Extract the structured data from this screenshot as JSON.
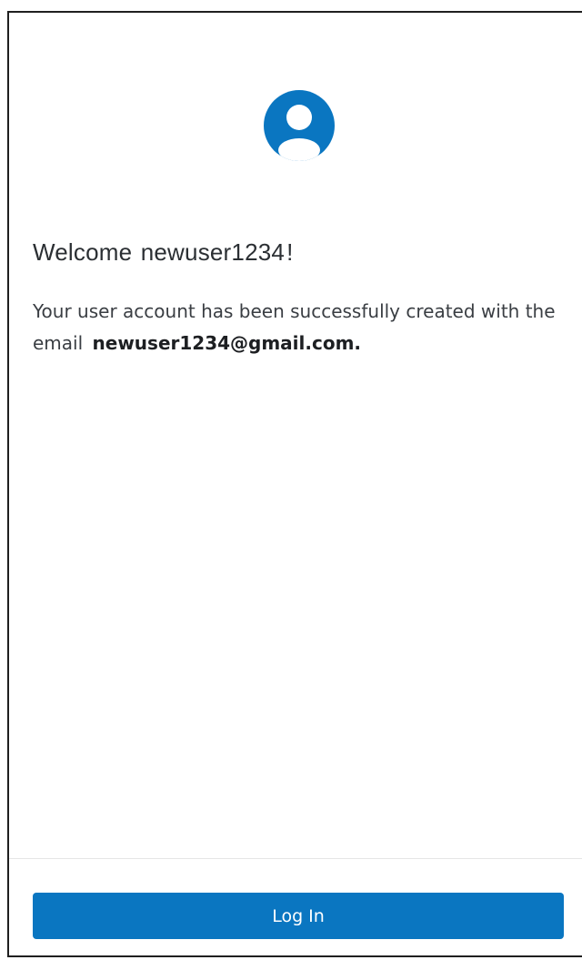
{
  "colors": {
    "accent": "#0a76c1",
    "text_primary": "#2b2f33",
    "text_secondary": "#3a3e43",
    "divider": "#e6e6e6"
  },
  "avatar": {
    "icon": "user-avatar-icon"
  },
  "welcome": {
    "greeting": "Welcome",
    "username": "newuser1234",
    "exclaim": "!"
  },
  "message": {
    "text": "Your user account has been successfully created with the email",
    "email": "newuser1234@gmail.com."
  },
  "actions": {
    "login_label": "Log In"
  }
}
